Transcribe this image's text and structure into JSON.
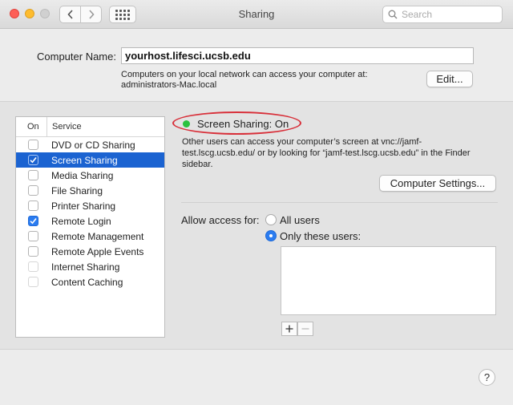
{
  "window": {
    "title": "Sharing"
  },
  "search": {
    "placeholder": "Search"
  },
  "computer_name": {
    "label": "Computer Name:",
    "value": "yourhost.lifesci.ucsb.edu",
    "info_line1": "Computers on your local network can access your computer at:",
    "info_line2": "administrators-Mac.local",
    "edit_label": "Edit..."
  },
  "services": {
    "header_on": "On",
    "header_service": "Service",
    "items": [
      {
        "label": "DVD or CD Sharing",
        "checked": false
      },
      {
        "label": "Screen Sharing",
        "checked": true,
        "selected": true
      },
      {
        "label": "Media Sharing",
        "checked": false
      },
      {
        "label": "File Sharing",
        "checked": false
      },
      {
        "label": "Printer Sharing",
        "checked": false
      },
      {
        "label": "Remote Login",
        "checked": true
      },
      {
        "label": "Remote Management",
        "checked": false
      },
      {
        "label": "Remote Apple Events",
        "checked": false
      },
      {
        "label": "Internet Sharing",
        "checked": false
      },
      {
        "label": "Content Caching",
        "checked": false
      }
    ]
  },
  "detail": {
    "status": "Screen Sharing: On",
    "desc_line1": "Other users can access your computer’s screen at vnc://jamf-",
    "desc_line2": "test.lscg.ucsb.edu/ or by looking for “jamf-test.lscg.ucsb.edu” in the Finder",
    "desc_line3": "sidebar.",
    "computer_settings_label": "Computer Settings...",
    "allow_access_label": "Allow access for:",
    "all_users_label": "All users",
    "only_users_label": "Only these users:",
    "selected_access": "only"
  },
  "colors": {
    "status_on": "#2ac23f",
    "selection": "#1b63d1",
    "highlight_ring": "#d8303a"
  }
}
